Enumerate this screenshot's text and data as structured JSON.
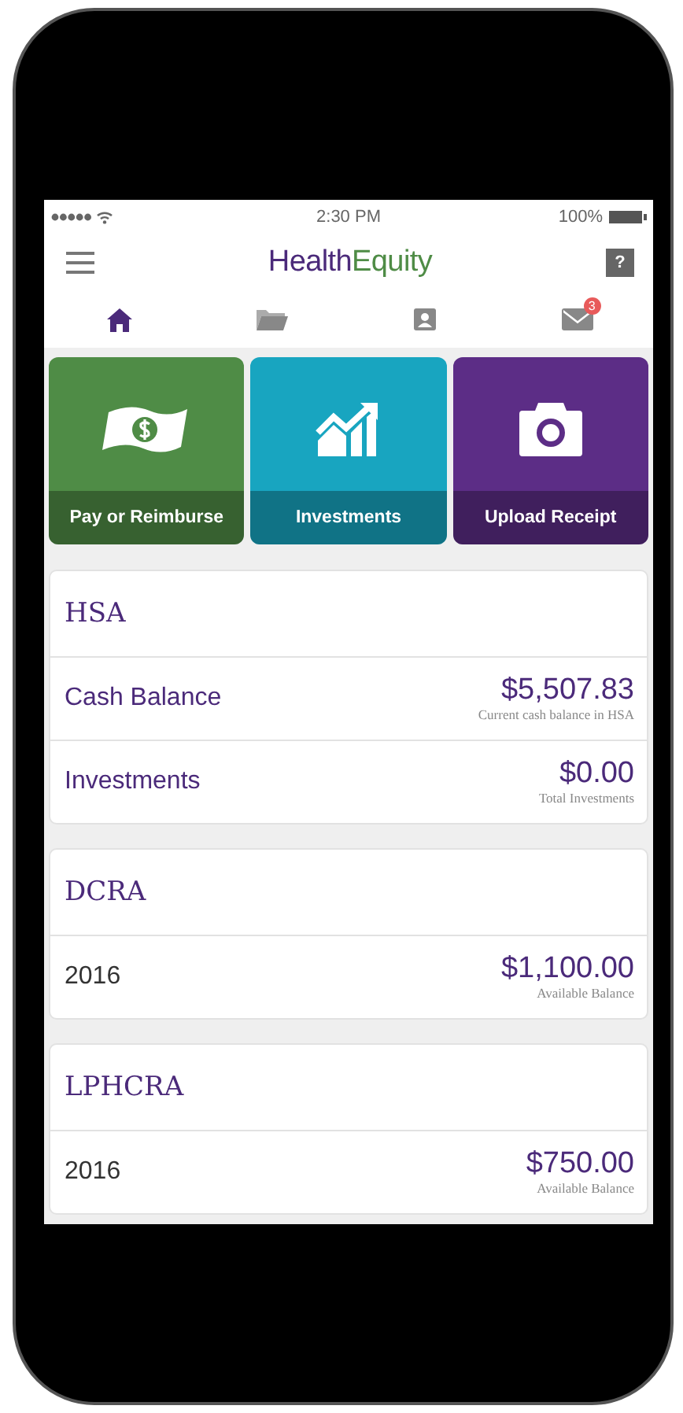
{
  "status_bar": {
    "time": "2:30 PM",
    "battery": "100%"
  },
  "header": {
    "logo_part_1": "Health",
    "logo_part_2": "Equity",
    "help": "?"
  },
  "tabs": [
    {
      "kind": "home",
      "selected": true
    },
    {
      "kind": "folder",
      "selected": false
    },
    {
      "kind": "contact",
      "selected": false
    },
    {
      "kind": "mail",
      "selected": false,
      "badge": "3"
    }
  ],
  "tiles": [
    {
      "kind": "money",
      "label": "Pay or Reimburse",
      "color": "#4f8c46"
    },
    {
      "kind": "chart",
      "label": "Investments",
      "color": "#18a5c0"
    },
    {
      "kind": "camera",
      "label": "Upload Receipt",
      "color": "#5c2d86"
    }
  ],
  "accounts": [
    {
      "title": "HSA",
      "rows": [
        {
          "kind": "balance",
          "label": "Cash Balance",
          "amount": "$5,507.83",
          "caption": "Current cash balance in HSA"
        },
        {
          "kind": "balance",
          "label": "Investments",
          "amount": "$0.00",
          "caption": "Total Investments"
        }
      ]
    },
    {
      "title": "DCRA",
      "rows": [
        {
          "kind": "plan-year",
          "label": "2016",
          "amount": "$1,100.00",
          "caption": "Available Balance"
        }
      ]
    },
    {
      "title": "LPHCRA",
      "rows": [
        {
          "kind": "plan-year",
          "label": "2016",
          "amount": "$750.00",
          "caption": "Available Balance"
        }
      ]
    }
  ]
}
